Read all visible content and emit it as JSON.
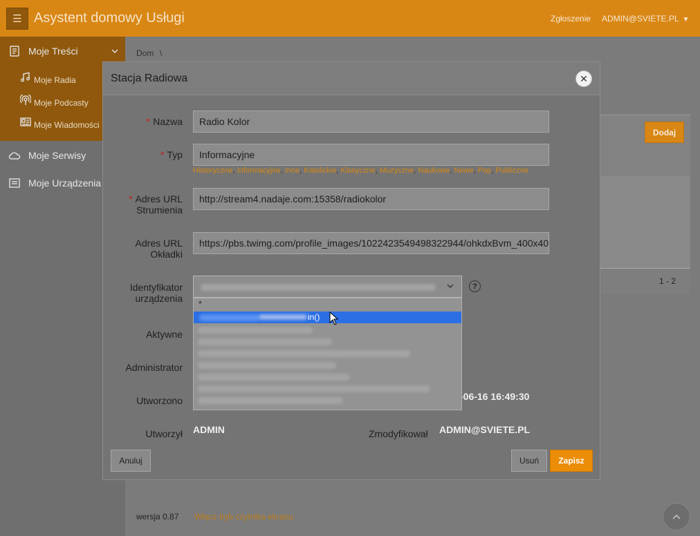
{
  "header": {
    "menu_icon": "hamburger-icon",
    "title": "Asystent domowy Usługi",
    "report_link": "Zgłoszenie",
    "user_menu": "ADMIN@SVIETE.PL",
    "user_caret": "▼"
  },
  "sidebar": {
    "items": [
      {
        "label": "Moje Treści",
        "icon": "content-icon",
        "expanded": true
      },
      {
        "label": "Moje Serwisy",
        "icon": "cloud-icon"
      },
      {
        "label": "Moje Urządzenia",
        "icon": "devices-icon"
      }
    ],
    "subitems": [
      {
        "label": "Moje Radia",
        "icon": "music-note-icon"
      },
      {
        "label": "Moje Podcasty",
        "icon": "podcast-icon"
      },
      {
        "label": "Moje Wiadomości",
        "icon": "news-icon"
      }
    ]
  },
  "main": {
    "breadcrumb": "Dom",
    "breadcrumb_separator": "\\",
    "add_button": "Dodaj",
    "pagination": "1 - 2",
    "footer_version": "wersja 0.87",
    "footer_link": "Włącz tryb czytnika ekranu",
    "scroll_top_icon": "chevron-up-icon"
  },
  "dialog": {
    "title": "Stacja Radiowa",
    "close_icon": "close-icon",
    "fields": {
      "name": {
        "label": "Nazwa",
        "required": true,
        "value": "Radio Kolor"
      },
      "type": {
        "label": "Typ",
        "required": true,
        "value": "Informacyjne"
      },
      "stream_url": {
        "label_line1": "Adres URL",
        "label_line2": "Strumienia",
        "required": true,
        "value": "http://stream4.nadaje.com:15358/radiokolor"
      },
      "cover_url": {
        "label_line1": "Adres URL",
        "label_line2": "Okładki",
        "value": "https://pbs.twimg.com/profile_images/1022423549498322944/ohkdxBvm_400x400.jpg"
      },
      "device_id": {
        "label_line1": "Identyfikator",
        "label_line2": "urządzenia",
        "help": "?"
      },
      "active": {
        "label": "Aktywne"
      },
      "administrator": {
        "label": "Administrator"
      },
      "created": {
        "label": "Utworzono",
        "value": "-06-16 16:49:30"
      },
      "created_by": {
        "label": "Utworzył",
        "value": "ADMIN"
      },
      "modified_by": {
        "label": "Zmodyfikował",
        "value": "ADMIN@SVIETE.PL"
      }
    },
    "type_suggestions": [
      "Historyczne",
      "Informacyjne",
      "Inne",
      "Katolickie",
      "Klasyczne",
      "Muzyczne",
      "Naukowe",
      "Nowe",
      "Pop",
      "Publiczne"
    ],
    "dropdown_options": [
      {
        "text": "*"
      },
      {
        "text": "                                in()",
        "selected": true
      },
      {
        "text": ""
      },
      {
        "text": "                                        11)"
      },
      {
        "text": ""
      },
      {
        "text": "        00455"
      },
      {
        "text": ""
      },
      {
        "text": ""
      },
      {
        "text": ""
      },
      {
        "text": "              tlas000"
      }
    ],
    "buttons": {
      "cancel": "Anuluj",
      "delete": "Usuń",
      "save": "Zapisz"
    }
  },
  "colors": {
    "accent": "#d98714",
    "accent_dark": "#8f580c",
    "selection": "#2c6fe4",
    "required": "#c8201d"
  }
}
